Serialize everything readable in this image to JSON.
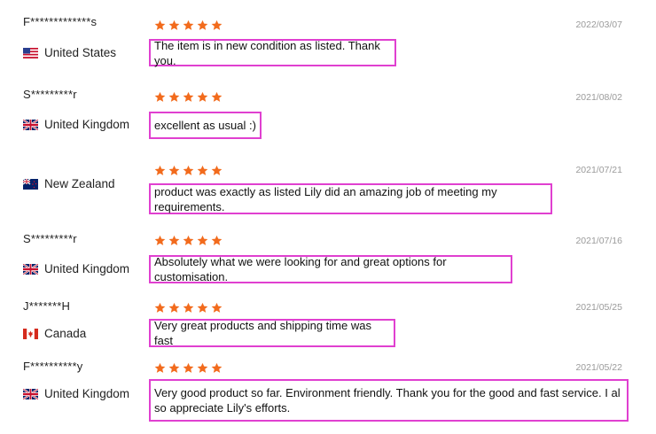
{
  "star_color": "#f26b1d",
  "highlight_color": "#e040d0",
  "reviews": [
    {
      "reviewer": "F*************s",
      "country": "United States",
      "flag": "us-flag-icon",
      "rating": 5,
      "date": "2022/03/07",
      "comment": "The item is in new condition as listed. Thank you."
    },
    {
      "reviewer": "S*********r",
      "country": "United Kingdom",
      "flag": "uk-flag-icon",
      "rating": 5,
      "date": "2021/08/02",
      "comment": "excellent as usual :)"
    },
    {
      "reviewer": "",
      "country": "New Zealand",
      "flag": "nz-flag-icon",
      "rating": 5,
      "date": "2021/07/21",
      "comment": "product was exactly as listed Lily did an amazing job of meeting my requirements."
    },
    {
      "reviewer": "S*********r",
      "country": "United Kingdom",
      "flag": "uk-flag-icon",
      "rating": 5,
      "date": "2021/07/16",
      "comment": "Absolutely what we were looking for and great options for customisation."
    },
    {
      "reviewer": "J*******H",
      "country": "Canada",
      "flag": "ca-flag-icon",
      "rating": 5,
      "date": "2021/05/25",
      "comment": "Very great products and shipping time was fast"
    },
    {
      "reviewer": "F**********y",
      "country": "United Kingdom",
      "flag": "uk-flag-icon",
      "rating": 5,
      "date": "2021/05/22",
      "comment": "Very good product so far. Environment friendly. Thank you for the good and fast service. I also appreciate Lily's efforts."
    }
  ]
}
